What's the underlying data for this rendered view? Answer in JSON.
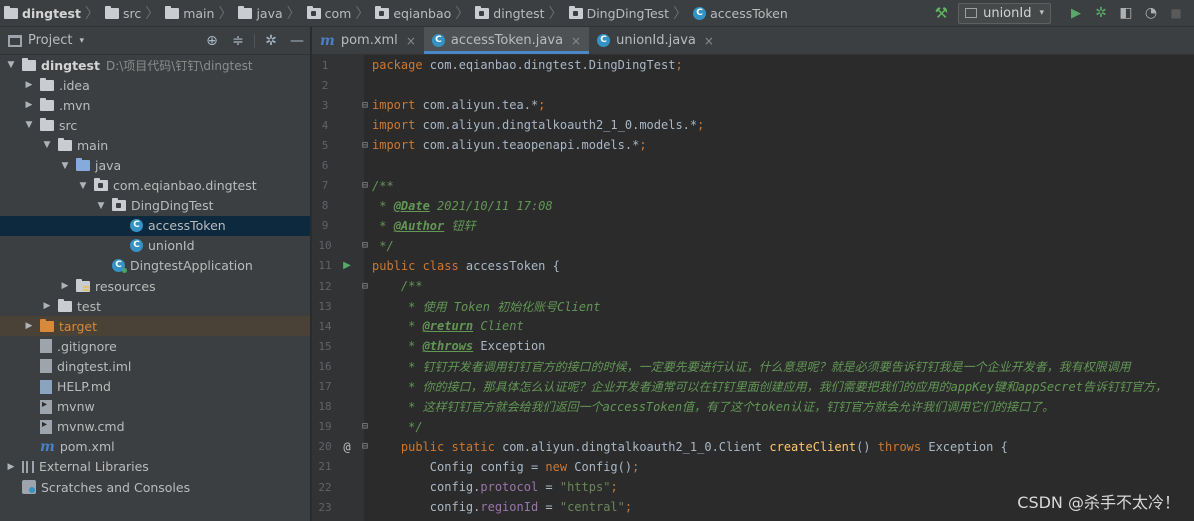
{
  "breadcrumbs": [
    {
      "label": "dingtest",
      "icon": "project-folder-icon"
    },
    {
      "label": "src",
      "icon": "folder-icon"
    },
    {
      "label": "main",
      "icon": "folder-icon"
    },
    {
      "label": "java",
      "icon": "folder-icon"
    },
    {
      "label": "com",
      "icon": "package-icon"
    },
    {
      "label": "eqianbao",
      "icon": "package-icon"
    },
    {
      "label": "dingtest",
      "icon": "package-icon"
    },
    {
      "label": "DingDingTest",
      "icon": "package-icon"
    },
    {
      "label": "accessToken",
      "icon": "class-icon"
    }
  ],
  "toolbar": {
    "run_config": "unionId",
    "run_config_dropdown": "▾",
    "icons": [
      "hammer-icon",
      "run-icon",
      "debug-icon",
      "coverage-icon",
      "profile-icon",
      "stop-icon"
    ]
  },
  "project_panel": {
    "title": "Project",
    "dropdown": "▾",
    "tree": [
      {
        "label": "dingtest",
        "path": "D:\\项目代码\\钉钉\\dingtest",
        "depth": 0,
        "toggle": "▼",
        "icon": "project-folder"
      },
      {
        "label": ".idea",
        "depth": 1,
        "toggle": "▶",
        "icon": "folder"
      },
      {
        "label": ".mvn",
        "depth": 1,
        "toggle": "▶",
        "icon": "folder"
      },
      {
        "label": "src",
        "depth": 1,
        "toggle": "▼",
        "icon": "folder"
      },
      {
        "label": "main",
        "depth": 2,
        "toggle": "▼",
        "icon": "folder"
      },
      {
        "label": "java",
        "depth": 3,
        "toggle": "▼",
        "icon": "source-folder"
      },
      {
        "label": "com.eqianbao.dingtest",
        "depth": 4,
        "toggle": "▼",
        "icon": "package"
      },
      {
        "label": "DingDingTest",
        "depth": 5,
        "toggle": "▼",
        "icon": "package"
      },
      {
        "label": "accessToken",
        "depth": 6,
        "toggle": "",
        "icon": "class",
        "selected": true
      },
      {
        "label": "unionId",
        "depth": 6,
        "toggle": "",
        "icon": "class"
      },
      {
        "label": "DingtestApplication",
        "depth": 5,
        "toggle": "",
        "icon": "spring-class"
      },
      {
        "label": "resources",
        "depth": 3,
        "toggle": "▶",
        "icon": "resources-folder"
      },
      {
        "label": "test",
        "depth": 2,
        "toggle": "▶",
        "icon": "folder"
      },
      {
        "label": "target",
        "depth": 1,
        "toggle": "▶",
        "icon": "excluded-folder",
        "highlighted": true
      },
      {
        "label": ".gitignore",
        "depth": 1,
        "toggle": "",
        "icon": "git-file"
      },
      {
        "label": "dingtest.iml",
        "depth": 1,
        "toggle": "",
        "icon": "iml-file"
      },
      {
        "label": "HELP.md",
        "depth": 1,
        "toggle": "",
        "icon": "md-file"
      },
      {
        "label": "mvnw",
        "depth": 1,
        "toggle": "",
        "icon": "shell-file"
      },
      {
        "label": "mvnw.cmd",
        "depth": 1,
        "toggle": "",
        "icon": "shell-file"
      },
      {
        "label": "pom.xml",
        "depth": 1,
        "toggle": "",
        "icon": "maven-file"
      },
      {
        "label": "External Libraries",
        "depth": 0,
        "toggle": "▶",
        "icon": "libraries"
      },
      {
        "label": "Scratches and Consoles",
        "depth": 0,
        "toggle": "",
        "icon": "scratches"
      }
    ]
  },
  "tabs": [
    {
      "label": "pom.xml",
      "icon": "maven-icon",
      "active": false
    },
    {
      "label": "accessToken.java",
      "icon": "class-icon",
      "active": true
    },
    {
      "label": "unionId.java",
      "icon": "class-icon",
      "active": false
    }
  ],
  "tab_close": "×",
  "code_lines": [
    {
      "n": "1",
      "html": "<span class=\"k\">package </span>com.eqianbao.dingtest.DingDingTest<span class=\"k\">;</span>"
    },
    {
      "n": "2",
      "html": ""
    },
    {
      "n": "3",
      "fold": "⊟",
      "html": "<span class=\"k\">import </span>com.aliyun.tea.*<span class=\"k\">;</span>"
    },
    {
      "n": "4",
      "html": "<span class=\"k\">import </span>com.aliyun.dingtalkoauth2_1_0.models.*<span class=\"k\">;</span>"
    },
    {
      "n": "5",
      "fold": "⊟",
      "html": "<span class=\"k\">import </span>com.aliyun.teaopenapi.models.*<span class=\"k\">;</span>"
    },
    {
      "n": "6",
      "html": ""
    },
    {
      "n": "7",
      "fold": "⊟",
      "html": "<span class=\"d\">/**</span>"
    },
    {
      "n": "8",
      "html": "<span class=\"d\"> * </span><span class=\"dt\">@Date</span><span class=\"d\"> 2021/10/11 17:08</span>"
    },
    {
      "n": "9",
      "html": "<span class=\"d\"> * </span><span class=\"dt\">@Author</span><span class=\"d\"> 钮轩</span>"
    },
    {
      "n": "10",
      "fold": "⊟",
      "html": "<span class=\"d\"> */</span>"
    },
    {
      "n": "11",
      "run": "▶",
      "html": "<span class=\"k\">public class </span>accessToken {"
    },
    {
      "n": "12",
      "fold": "⊟",
      "html": "    <span class=\"d\">/**</span>"
    },
    {
      "n": "13",
      "html": "<span class=\"d\">     * 使用 Token 初始化账号Client</span>"
    },
    {
      "n": "14",
      "html": "<span class=\"d\">     * </span><span class=\"dt\">@return</span><span class=\"d\"> Client</span>"
    },
    {
      "n": "15",
      "html": "<span class=\"d\">     * </span><span class=\"dt\">@throws</span><span class=\"d\" style=\"font-style:normal;color:#a9b7c6\"> Exception</span>"
    },
    {
      "n": "16",
      "html": "<span class=\"d\">     * 钉钉开发者调用钉钉官方的接口的时候，一定要先要进行认证，什么意思呢？就是必须要告诉钉钉我是一个企业开发者，我有权限调用</span>"
    },
    {
      "n": "17",
      "html": "<span class=\"d\">     * 你的接口，那具体怎么认证呢？企业开发者通常可以在钉钉里面创建应用，我们需要把我们的应用的appKey键和appSecret告诉钉钉官方，</span>"
    },
    {
      "n": "18",
      "html": "<span class=\"d\">     * 这样钉钉官方就会给我们返回一个accessToken值，有了这个token认证，钉钉官方就会允许我们调用它们的接口了。</span>"
    },
    {
      "n": "19",
      "fold": "⊟",
      "html": "<span class=\"d\">     */</span>"
    },
    {
      "n": "20",
      "at": "@",
      "fold": "⊟",
      "html": "    <span class=\"k\">public static </span>com.aliyun.dingtalkoauth2_1_0.Client <span class=\"fn\">createClient</span>() <span class=\"k\">throws </span>Exception {"
    },
    {
      "n": "21",
      "html": "        Config config = <span class=\"k\">new </span>Config()<span class=\"k\">;</span>"
    },
    {
      "n": "22",
      "html": "        config.<span class=\"f\">protocol </span>= <span class=\"s\">\"https\"</span><span class=\"k\">;</span>"
    },
    {
      "n": "23",
      "html": "        config.<span class=\"f\">regionId </span>= <span class=\"s\">\"central\"</span><span class=\"k\">;</span>"
    }
  ],
  "watermark": "CSDN @杀手不太冷！"
}
